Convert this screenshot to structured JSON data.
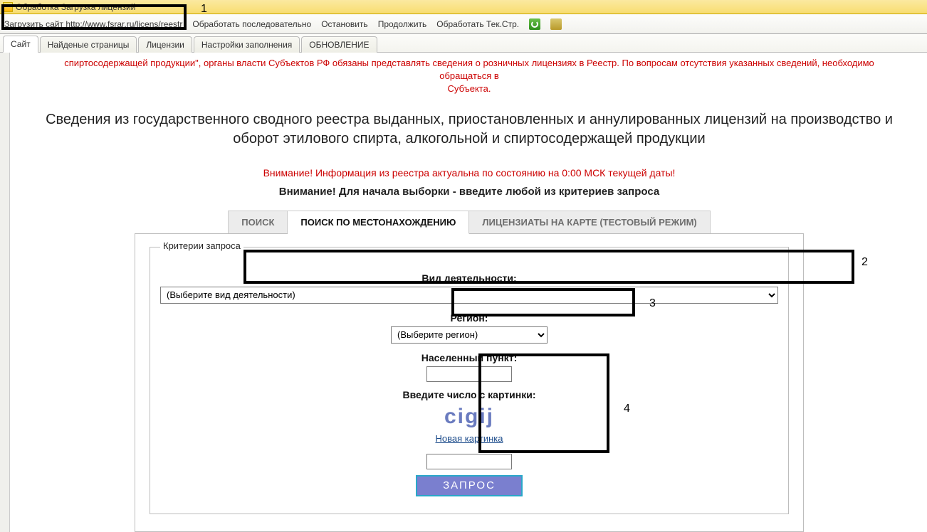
{
  "window": {
    "title": "Обработка   Загрузка лицензий"
  },
  "toolbar": {
    "load_site": "Загрузить сайт http://www.fsrar.ru/licens/reestr",
    "process_seq": "Обработать последовательно",
    "stop": "Остановить",
    "continue": "Продолжить",
    "process_current": "Обработать Тек.Стр."
  },
  "doc_tabs": {
    "site": "Сайт",
    "found_pages": "Найденые страницы",
    "licenses": "Лицензии",
    "fill_settings": "Настройки заполнения",
    "update": "ОБНОВЛЕНИЕ"
  },
  "page": {
    "red_note_line1": "спиртосодержащей продукции\", органы власти Субъектов РФ обязаны представлять сведения о розничных лицензиях в Реестр. По вопросам отсутствия указанных сведений, необходимо обращаться в",
    "red_note_line2": "Субъекта.",
    "big_title": "Сведения из государственного сводного реестра выданных, приостановленных и аннулированных лицензий на производство и оборот этилового спирта, алкогольной и спиртосодержащей продукции",
    "red_warning": "Внимание! Информация из реестра актуальна по состоянию на 0:00 МСК текущей даты!",
    "black_note": "Внимание! Для начала выборки - введите любой из критериев запроса",
    "inner_tabs": {
      "search": "ПОИСК",
      "search_location": "ПОИСК ПО МЕСТОНАХОЖДЕНИЮ",
      "map": "ЛИЦЕНЗИАТЫ НА КАРТЕ (ТЕСТОВЫЙ РЕЖИМ)"
    },
    "fieldset_legend": "Критерии запроса",
    "labels": {
      "activity": "Вид деятельности:",
      "region": "Регион:",
      "locality": "Населенный пункт:",
      "captcha": "Введите число с картинки:"
    },
    "selects": {
      "activity_placeholder": "(Выберите вид деятельности)",
      "region_placeholder": "(Выберите регион)"
    },
    "captcha_text": "cigij",
    "captcha_new": "Новая картинка",
    "submit": "ЗАПРОС"
  },
  "annotations": {
    "n1": "1",
    "n2": "2",
    "n3": "3",
    "n4": "4"
  }
}
